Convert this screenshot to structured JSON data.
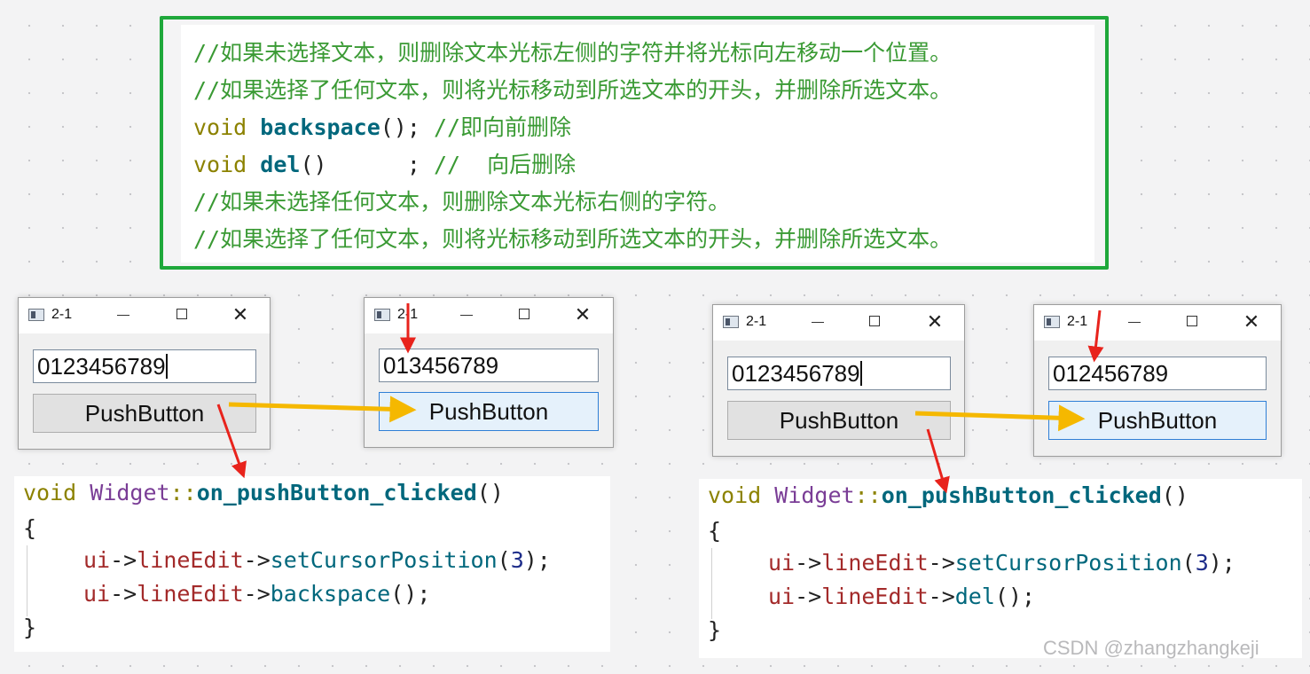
{
  "top_code": {
    "lines": [
      "//如果未选择文本，则删除文本光标左侧的字符并将光标向左移动一个位置。",
      "//如果选择了任何文本，则将光标移动到所选文本的开头，并删除所选文本。",
      {
        "kw": "void",
        "fn": "backspace",
        "rest": "();",
        "comment": " //即向前删除"
      },
      {
        "kw": "void",
        "fn": "del",
        "rest": "()      ;",
        "comment": " //  向后删除"
      },
      "//如果未选择任何文本，则删除文本光标右侧的字符。",
      "//如果选择了任何文本，则将光标移动到所选文本的开头，并删除所选文本。"
    ]
  },
  "windows": [
    {
      "title": "2-1",
      "line_edit": "0123456789",
      "button": "PushButton"
    },
    {
      "title": "2-1",
      "line_edit": "013456789",
      "button": "PushButton"
    },
    {
      "title": "2-1",
      "line_edit": "0123456789",
      "button": "PushButton"
    },
    {
      "title": "2-1",
      "line_edit": "012456789",
      "button": "PushButton"
    }
  ],
  "code_left": {
    "kw": "void",
    "class": "Widget",
    "sep": "::",
    "fn": "on_pushButton_clicked",
    "parens": "()",
    "open": "{",
    "obj": "ui",
    "arrow": "->",
    "member": "lineEdit",
    "call1": "setCursorPosition",
    "arg": "3",
    "call2": "backspace",
    "close": "}"
  },
  "code_right": {
    "kw": "void",
    "class": "Widget",
    "sep": "::",
    "fn": "on_pushButton_clicked",
    "parens": "()",
    "open": "{",
    "obj": "ui",
    "arrow": "->",
    "member": "lineEdit",
    "call1": "setCursorPosition",
    "arg": "3",
    "call2": "del",
    "close": "}"
  },
  "watermark": "CSDN @zhangzhangkeji",
  "colors": {
    "green_border": "#1fa83b",
    "arrow_orange": "#f5b800",
    "arrow_red": "#e8231c"
  }
}
